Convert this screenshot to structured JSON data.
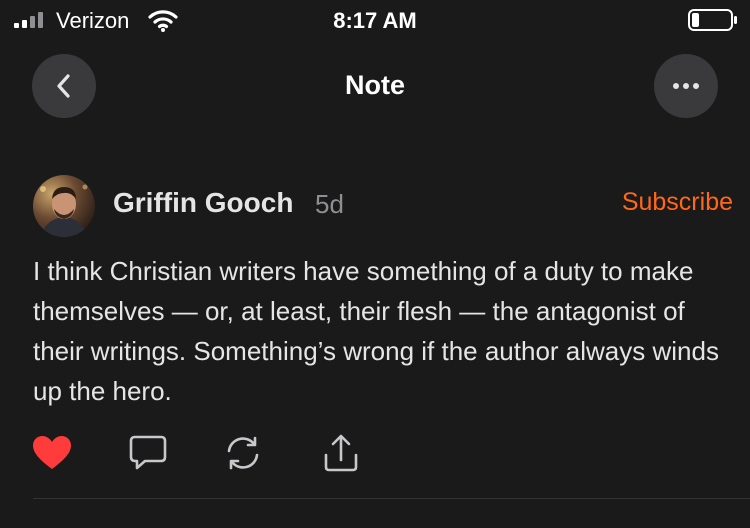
{
  "status_bar": {
    "carrier": "Verizon",
    "time": "8:17 AM"
  },
  "nav": {
    "title": "Note",
    "back_icon": "chevron-left-icon",
    "more_icon": "ellipsis-icon"
  },
  "note": {
    "author": "Griffin Gooch",
    "age": "5d",
    "subscribe_label": "Subscribe",
    "body": "I think Christian writers have something of a duty to make themselves — or, at least, their flesh — the antagonist of their writings. Something’s wrong if the author always winds up the hero.",
    "actions": {
      "like_icon": "heart-icon",
      "comment_icon": "comment-icon",
      "restack_icon": "restack-icon",
      "share_icon": "share-icon"
    }
  },
  "colors": {
    "background": "#1a1a1a",
    "accent": "#ff6719",
    "like": "#ff3b3b",
    "text": "#e5e5e5",
    "muted": "#8e8e93"
  }
}
